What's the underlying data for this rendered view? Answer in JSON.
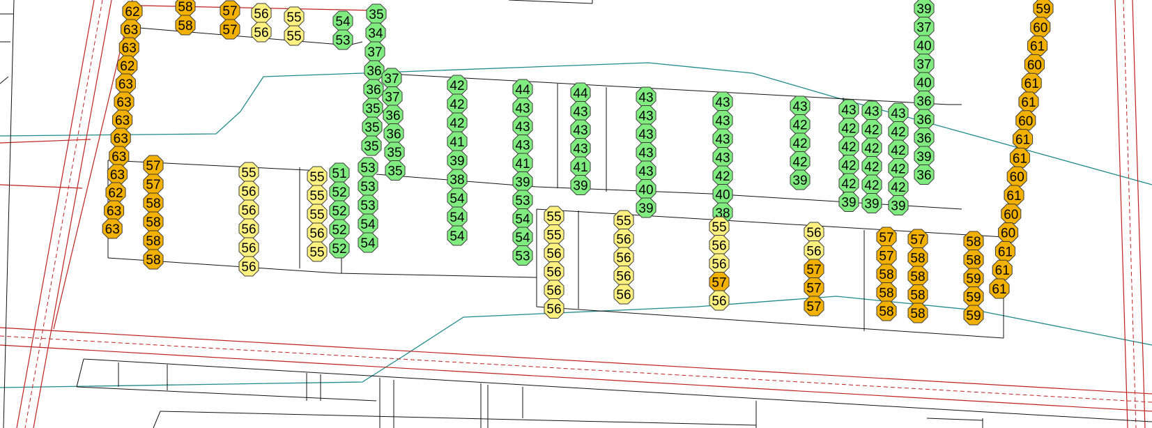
{
  "colors": {
    "background": "#ffffff",
    "green": "#80ec80",
    "yellow": "#fff180",
    "orange": "#f2b000",
    "marker_stroke": "#3a3a3a",
    "road": "#c02020",
    "water": "#1f8a8a",
    "building": "#000000"
  },
  "legend_note": "",
  "facades": {
    "inner_left": [
      [
        "35",
        "34",
        "37",
        "36",
        "36",
        "35",
        "35",
        "35"
      ],
      [
        "37",
        "37",
        "36",
        "36",
        "35",
        "35"
      ],
      [
        "53",
        "53",
        "53",
        "54",
        "54"
      ],
      [
        "51",
        "52",
        "52",
        "52",
        "52"
      ],
      [
        "55",
        "55",
        "55",
        "56",
        "55"
      ]
    ],
    "north_inner": [
      [
        "42",
        "42",
        "42",
        "41",
        "39",
        "38",
        "54",
        "54",
        "54"
      ],
      [
        "44",
        "43",
        "43",
        "43",
        "41",
        "39",
        "53",
        "54",
        "54",
        "53"
      ],
      [
        "44",
        "43",
        "43",
        "43",
        "41",
        "39"
      ],
      [
        "43",
        "43",
        "43",
        "43",
        "43",
        "40",
        "39"
      ],
      [
        "43",
        "43",
        "43",
        "43",
        "42",
        "40",
        "38"
      ],
      [
        "43",
        "42",
        "42",
        "42",
        "39"
      ],
      [
        "43",
        "42",
        "42",
        "42",
        "42",
        "39"
      ],
      [
        "43",
        "42",
        "42",
        "42",
        "42",
        "39"
      ],
      [
        "43",
        "42",
        "42",
        "42",
        "42",
        "39"
      ]
    ],
    "right_inner": [
      [
        "39",
        "37",
        "40",
        "37",
        "40",
        "36",
        "36",
        "36",
        "39",
        "36"
      ]
    ],
    "south_middle": [
      [
        "55",
        "55",
        "56",
        "56",
        "56",
        "56"
      ],
      [
        "55",
        "56",
        "56",
        "56",
        "56"
      ],
      [
        "55",
        "56",
        "56",
        "57",
        "56"
      ],
      [
        "56",
        "56",
        "57",
        "57",
        "57"
      ],
      [
        "57",
        "57",
        "58",
        "58",
        "58"
      ],
      [
        "57",
        "58",
        "58",
        "58",
        "58"
      ],
      [
        "58",
        "58",
        "59",
        "59",
        "59"
      ]
    ],
    "south_left": [
      [
        "57",
        "57",
        "58",
        "58",
        "58",
        "58"
      ],
      [
        "55",
        "56",
        "56",
        "56",
        "56",
        "56"
      ]
    ],
    "outer_left": [
      [
        "62",
        "63",
        "63",
        "62",
        "63",
        "63",
        "63",
        "63",
        "63",
        "63",
        "62",
        "63",
        "63"
      ]
    ],
    "top_left": [
      [
        "58",
        "58"
      ],
      [
        "57",
        "57"
      ],
      [
        "56",
        "56"
      ],
      [
        "55",
        "55"
      ],
      [
        "54",
        "53"
      ]
    ],
    "outer_right": [
      [
        "59",
        "60",
        "61",
        "60",
        "61",
        "61",
        "60",
        "61",
        "61",
        "60",
        "61",
        "60",
        "60",
        "61",
        "61",
        "61"
      ]
    ]
  }
}
